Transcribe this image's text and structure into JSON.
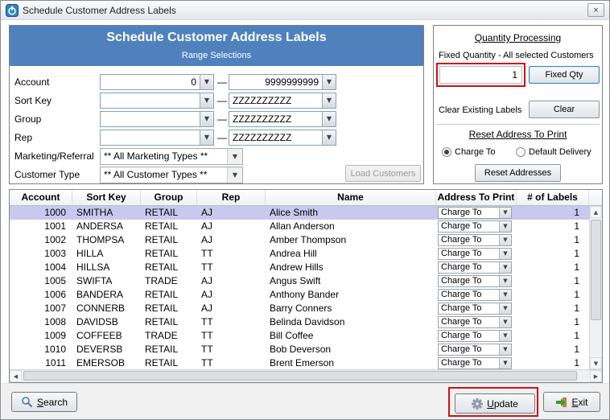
{
  "window": {
    "title": "Schedule Customer Address Labels"
  },
  "glyphs": {
    "dropdown": "▼",
    "close": "×",
    "dash": "—",
    "up": "▲",
    "down": "▼",
    "left": "◀",
    "right": "▶"
  },
  "range_panel": {
    "title": "Schedule Customer Address Labels",
    "subtitle": "Range Selections",
    "rows": [
      {
        "label": "Account",
        "from": "0",
        "to": "9999999999",
        "align": "right"
      },
      {
        "label": "Sort Key",
        "from": "",
        "to": "ZZZZZZZZZZ",
        "align": "left"
      },
      {
        "label": "Group",
        "from": "",
        "to": "ZZZZZZZZZZ",
        "align": "left"
      },
      {
        "label": "Rep",
        "from": "",
        "to": "ZZZZZZZZZZ",
        "align": "left"
      }
    ],
    "marketing": {
      "label": "Marketing/Referral",
      "value": "** All Marketing Types **"
    },
    "customer_type": {
      "label": "Customer Type",
      "value": "** All Customer Types **"
    },
    "load_customers_label": "Load Customers"
  },
  "quantity_panel": {
    "title": "Quantity Processing",
    "fixed_quantity_label": "Fixed Quantity - All selected Customers",
    "fixed_quantity_value": "1",
    "fixed_qty_button": "Fixed Qty",
    "clear_label": "Clear Existing Labels",
    "clear_button": "Clear",
    "reset_title": "Reset Address To Print",
    "radio_options": [
      "Charge To",
      "Default Delivery"
    ],
    "radio_selected": "Charge To",
    "reset_button": "Reset Addresses"
  },
  "table": {
    "columns": [
      "Account",
      "Sort Key",
      "Group",
      "Rep",
      "Name",
      "Address To Print",
      "# of Labels"
    ],
    "selected_index": 0,
    "rows": [
      {
        "account": "1000",
        "sort_key": "SMITHA",
        "group": "RETAIL",
        "rep": "AJ",
        "name": "Alice Smith",
        "address": "Charge To",
        "labels": "1"
      },
      {
        "account": "1001",
        "sort_key": "ANDERSA",
        "group": "RETAIL",
        "rep": "AJ",
        "name": "Allan Anderson",
        "address": "Charge To",
        "labels": "1"
      },
      {
        "account": "1002",
        "sort_key": "THOMPSA",
        "group": "RETAIL",
        "rep": "AJ",
        "name": "Amber Thompson",
        "address": "Charge To",
        "labels": "1"
      },
      {
        "account": "1003",
        "sort_key": "HILLA",
        "group": "RETAIL",
        "rep": "TT",
        "name": "Andrea Hill",
        "address": "Charge To",
        "labels": "1"
      },
      {
        "account": "1004",
        "sort_key": "HILLSA",
        "group": "RETAIL",
        "rep": "TT",
        "name": "Andrew Hills",
        "address": "Charge To",
        "labels": "1"
      },
      {
        "account": "1005",
        "sort_key": "SWIFTA",
        "group": "TRADE",
        "rep": "AJ",
        "name": "Angus Swift",
        "address": "Charge To",
        "labels": "1"
      },
      {
        "account": "1006",
        "sort_key": "BANDERA",
        "group": "RETAIL",
        "rep": "AJ",
        "name": "Anthony Bander",
        "address": "Charge To",
        "labels": "1"
      },
      {
        "account": "1007",
        "sort_key": "CONNERB",
        "group": "RETAIL",
        "rep": "AJ",
        "name": "Barry Conners",
        "address": "Charge To",
        "labels": "1"
      },
      {
        "account": "1008",
        "sort_key": "DAVIDSB",
        "group": "RETAIL",
        "rep": "TT",
        "name": "Belinda Davidson",
        "address": "Charge To",
        "labels": "1"
      },
      {
        "account": "1009",
        "sort_key": "COFFEEB",
        "group": "TRADE",
        "rep": "TT",
        "name": "Bill Coffee",
        "address": "Charge To",
        "labels": "1"
      },
      {
        "account": "1010",
        "sort_key": "DEVERSB",
        "group": "RETAIL",
        "rep": "TT",
        "name": "Bob Deverson",
        "address": "Charge To",
        "labels": "1"
      },
      {
        "account": "1011",
        "sort_key": "EMERSOB",
        "group": "RETAIL",
        "rep": "TT",
        "name": "Brent Emerson",
        "address": "Charge To",
        "labels": "1"
      }
    ]
  },
  "footer": {
    "search_label": "Search",
    "update_label": "Update",
    "exit_label": "Exit"
  },
  "colors": {
    "header_blue": "#4f81bd",
    "selected_row": "#c9c9ef",
    "highlight_red": "#cc1111",
    "focus_border": "#3c7fb1"
  }
}
